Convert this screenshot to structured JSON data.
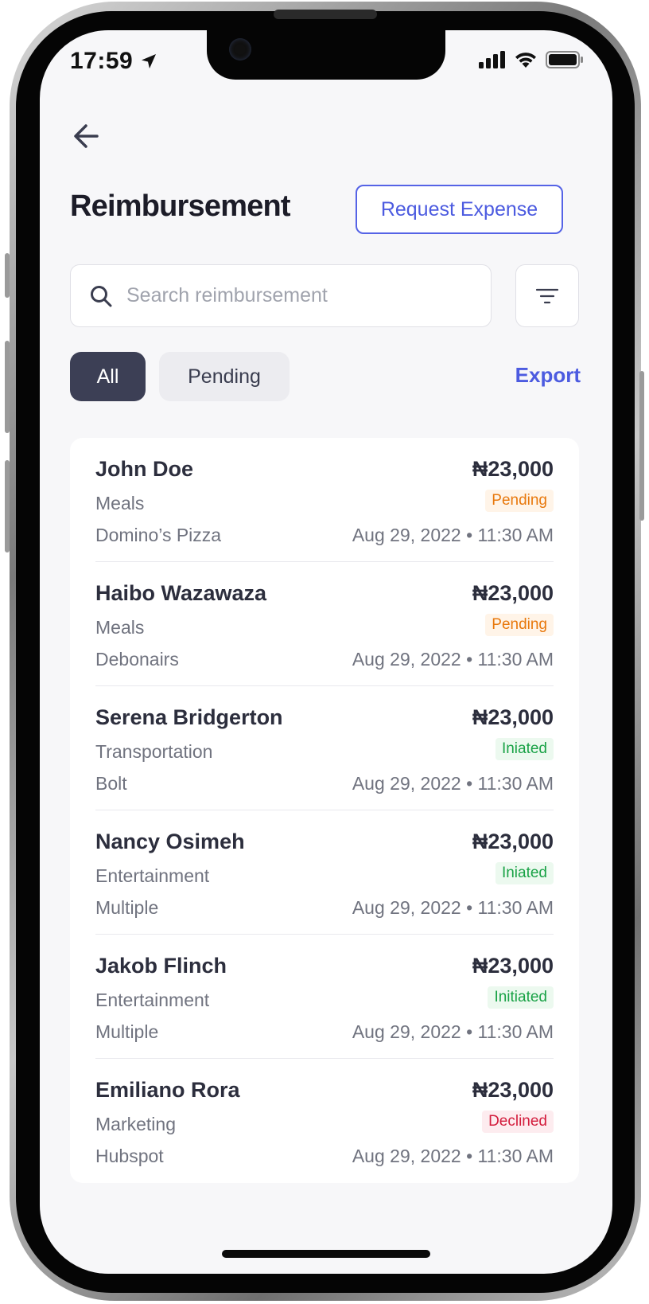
{
  "status_bar": {
    "time": "17:59"
  },
  "header": {
    "title": "Reimbursement",
    "request_button": "Request Expense"
  },
  "search": {
    "placeholder": "Search reimbursement",
    "value": ""
  },
  "filters": {
    "chips": [
      "All",
      "Pending"
    ],
    "selected": "All",
    "export_label": "Export"
  },
  "reimbursements": [
    {
      "name": "John Doe",
      "amount": "₦23,000",
      "category": "Meals",
      "status": "Pending",
      "merchant": "Domino’s Pizza",
      "datetime": "Aug 29, 2022 • 11:30 AM"
    },
    {
      "name": "Haibo Wazawaza",
      "amount": "₦23,000",
      "category": "Meals",
      "status": "Pending",
      "merchant": "Debonairs",
      "datetime": "Aug 29, 2022 • 11:30 AM"
    },
    {
      "name": "Serena Bridgerton",
      "amount": "₦23,000",
      "category": "Transportation",
      "status": "Iniated",
      "merchant": "Bolt",
      "datetime": "Aug 29, 2022 • 11:30 AM"
    },
    {
      "name": "Nancy Osimeh",
      "amount": "₦23,000",
      "category": "Entertainment",
      "status": "Iniated",
      "merchant": "Multiple",
      "datetime": "Aug 29, 2022 • 11:30 AM"
    },
    {
      "name": "Jakob Flinch",
      "amount": "₦23,000",
      "category": "Entertainment",
      "status": "Initiated",
      "merchant": "Multiple",
      "datetime": "Aug 29, 2022 • 11:30 AM"
    },
    {
      "name": "Emiliano Rora",
      "amount": "₦23,000",
      "category": "Marketing",
      "status": "Declined",
      "merchant": "Hubspot",
      "datetime": "Aug 29, 2022 • 11:30 AM"
    }
  ],
  "colors": {
    "accent": "#4c5be0",
    "chip_active": "#3c3f55",
    "pending": "#e8780c",
    "initiated": "#19a246",
    "declined": "#d31c3c"
  },
  "icons": {
    "back": "arrow-left-icon",
    "search": "search-icon",
    "filter": "filter-icon",
    "location": "location-arrow-icon",
    "signal": "cellular-signal-icon",
    "wifi": "wifi-icon",
    "battery": "battery-icon"
  }
}
